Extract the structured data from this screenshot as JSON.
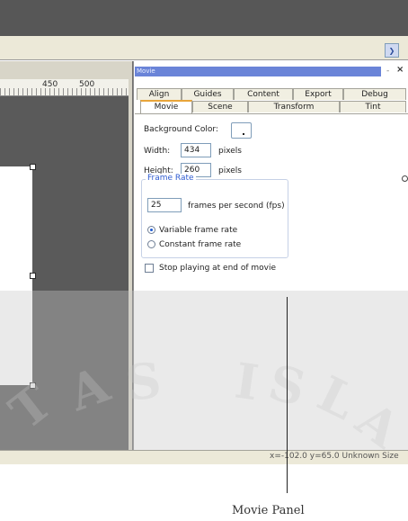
{
  "canvas": {
    "ruler_labels": [
      "450",
      "500"
    ]
  },
  "panel": {
    "title": "Movie",
    "close": "×",
    "tabs_row1": [
      "Align",
      "Guides",
      "Content",
      "Export",
      "Debug"
    ],
    "tabs_row2": [
      "Movie",
      "Scene",
      "Transform",
      "Tint"
    ],
    "active_tab": "Movie",
    "background_color_label": "Background Color:",
    "width_label": "Width:",
    "width_value": "434",
    "width_unit": "pixels",
    "height_label": "Height:",
    "height_value": "260",
    "height_unit": "pixels",
    "frame_rate_legend": "Frame Rate",
    "fps_value": "25",
    "fps_label": "frames per second (fps)",
    "variable_label": "Variable frame rate",
    "constant_label": "Constant frame rate",
    "selected_rate_mode": "Variable frame rate",
    "stop_playing_label": "Stop playing at end of movie",
    "stop_playing_checked": false
  },
  "status": {
    "text": "x=-102.0 y=65.0  Unknown Size"
  },
  "callout": {
    "label": "Movie Panel"
  },
  "colors": {
    "toolbar": "#575757",
    "stage": "#5a5a5a",
    "panel_title": "#6a84d8",
    "active_tab_accent": "#e8a53a",
    "frame_rate_legend": "#2e5bd0"
  }
}
